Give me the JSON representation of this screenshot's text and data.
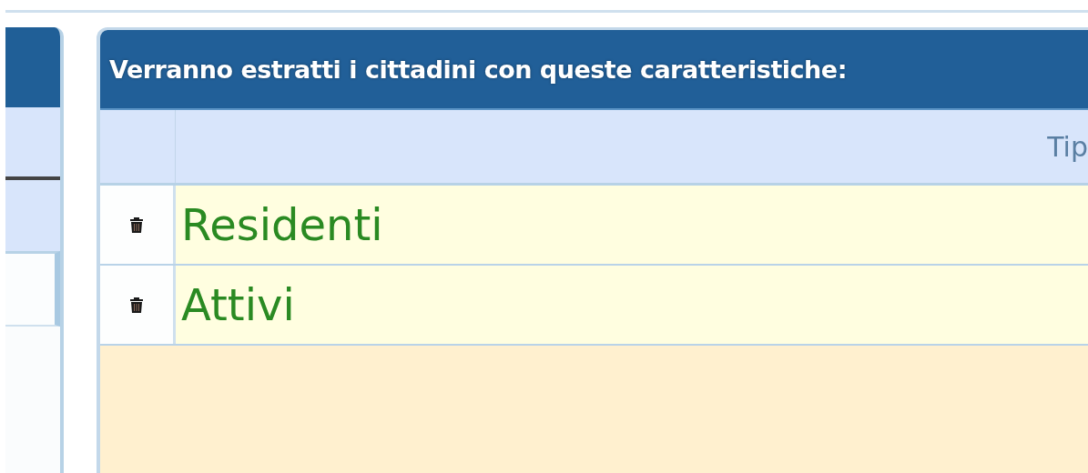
{
  "panel": {
    "title": "Verranno estratti i cittadini con queste caratteristiche:",
    "column_header": "Tip"
  },
  "rows": [
    {
      "label": "Residenti"
    },
    {
      "label": "Attivi"
    }
  ]
}
